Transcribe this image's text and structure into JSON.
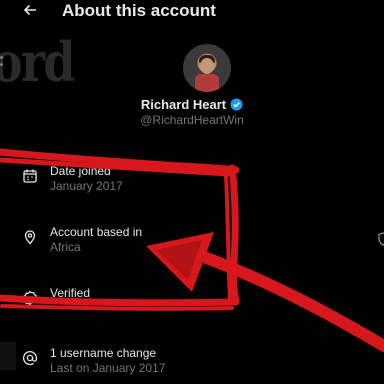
{
  "header": {
    "title": "About this account",
    "back_icon": "arrow-left-icon"
  },
  "watermark": {
    "text": "ord"
  },
  "profile": {
    "name": "Richard Heart",
    "handle": "@RichardHeartWin",
    "verified_color": "#1d9bf0"
  },
  "details": [
    {
      "icon": "calendar-icon",
      "label": "Date joined",
      "value": "January 2017"
    },
    {
      "icon": "location-pin-icon",
      "label": "Account based in",
      "value": "Africa"
    },
    {
      "icon": "verified-check-icon",
      "label": "Verified",
      "value": ""
    },
    {
      "icon": "at-sign-icon",
      "label": "1 username change",
      "value": "Last on January 2017"
    }
  ],
  "annotation": {
    "color": "#d6171b"
  }
}
